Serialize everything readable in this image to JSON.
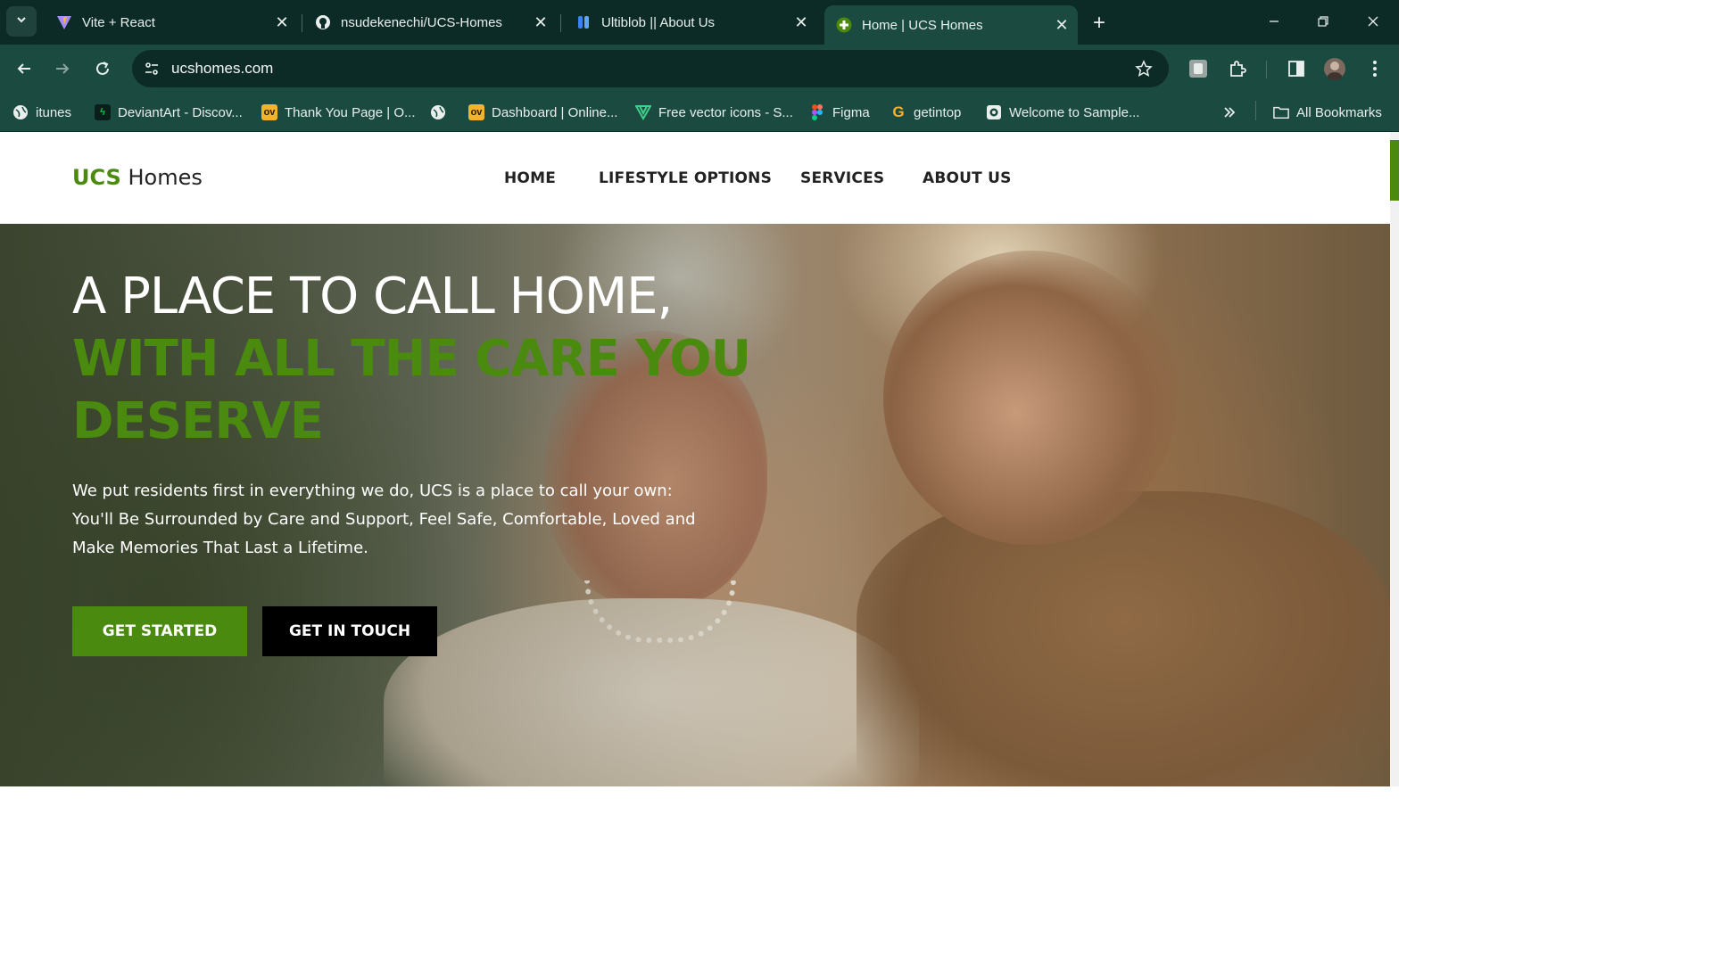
{
  "browser": {
    "tabs": [
      {
        "title": "Vite + React",
        "icon": "vite-icon"
      },
      {
        "title": "nsudekenechi/UCS-Homes",
        "icon": "github-icon"
      },
      {
        "title": "Ultiblob || About Us",
        "icon": "ultiblob-icon"
      },
      {
        "title": "Home | UCS Homes",
        "icon": "ucs-favicon",
        "active": true
      }
    ],
    "url": "ucshomes.com",
    "bookmarks": [
      {
        "label": "itunes",
        "icon": "globe-icon"
      },
      {
        "label": "DeviantArt - Discov...",
        "icon": "deviantart-icon"
      },
      {
        "label": "Thank You Page | O...",
        "icon": "ov-icon"
      },
      {
        "label": "",
        "icon": "globe-icon"
      },
      {
        "label": "Dashboard | Online...",
        "icon": "ov-icon"
      },
      {
        "label": "Free vector icons - S...",
        "icon": "vector-icon"
      },
      {
        "label": "Figma",
        "icon": "figma-icon"
      },
      {
        "label": "getintop",
        "icon": "g-icon"
      },
      {
        "label": "Welcome to Sample...",
        "icon": "camera-icon"
      }
    ],
    "all_bookmarks_label": "All Bookmarks"
  },
  "site": {
    "logo_accent": "UCS",
    "logo_rest": "Homes",
    "nav": [
      "HOME",
      "LIFESTYLE OPTIONS",
      "SERVICES",
      "ABOUT US"
    ],
    "hero": {
      "line1": "A PLACE TO CALL HOME,",
      "line2": "WITH ALL THE CARE YOU DESERVE",
      "paragraph": "We put residents first in everything we do, UCS is a place to call your own: You'll Be Surrounded by Care and Support, Feel Safe, Comfortable, Loved and Make Memories That Last a Lifetime.",
      "primary_button": "GET STARTED",
      "secondary_button": "GET IN TOUCH"
    },
    "colors": {
      "accent": "#4a8a0f",
      "chrome_dark": "#0d2b26",
      "chrome": "#1b4a40"
    }
  }
}
